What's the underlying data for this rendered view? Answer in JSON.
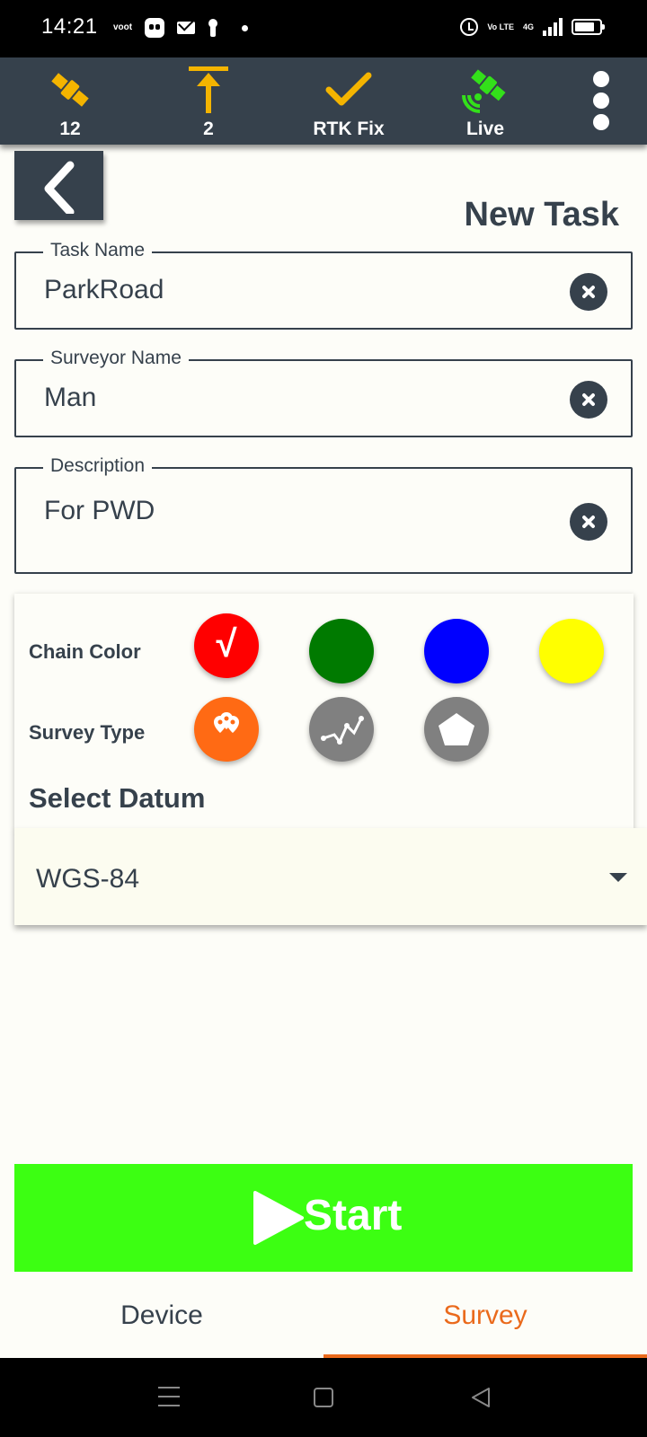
{
  "status_bar": {
    "time": "14:21",
    "left_icons": [
      "voot-icon",
      "app-icon",
      "mail-icon",
      "key-icon",
      "dot-icon"
    ],
    "right_icons": [
      "alarm-icon",
      "volte-icon",
      "signal-4g-icon",
      "battery-icon"
    ],
    "voot_label": "voot",
    "volte_label": "Vo LTE",
    "net_label": "4G"
  },
  "header": {
    "items": [
      {
        "icon": "satellite-icon",
        "label": "12",
        "color": "#f4b400"
      },
      {
        "icon": "antenna-height-icon",
        "label": "2",
        "color": "#f4b400"
      },
      {
        "icon": "check-icon",
        "label": "RTK Fix",
        "color": "#f4b400"
      },
      {
        "icon": "live-satellite-icon",
        "label": "Live",
        "color": "#33e01a"
      }
    ],
    "menu_icon": "more-vertical-icon",
    "background": "#36414c"
  },
  "page": {
    "back_icon": "chevron-left-icon",
    "title": "New Task"
  },
  "form": {
    "task_name": {
      "label": "Task Name",
      "value": "ParkRoad"
    },
    "surveyor_name": {
      "label": "Surveyor Name",
      "value": "Man"
    },
    "description": {
      "label": "Description",
      "value": "For PWD"
    }
  },
  "options": {
    "chain_color_label": "Chain Color",
    "chain_colors": [
      {
        "color": "#ff0000",
        "selected": true,
        "check": "√"
      },
      {
        "color": "#007a00",
        "selected": false
      },
      {
        "color": "#0000ff",
        "selected": false
      },
      {
        "color": "#ffff00",
        "selected": false
      }
    ],
    "survey_type_label": "Survey Type",
    "survey_types": [
      {
        "icon": "points-icon",
        "color": "#ff6a14",
        "selected": true
      },
      {
        "icon": "line-icon",
        "color": "#808080",
        "selected": false
      },
      {
        "icon": "polygon-icon",
        "color": "#808080",
        "selected": false
      }
    ],
    "datum_label": "Select Datum",
    "datum_value": "WGS-84"
  },
  "actions": {
    "start_label": "Start",
    "start_color": "#3cff12"
  },
  "tabs": [
    {
      "label": "Device",
      "active": false
    },
    {
      "label": "Survey",
      "active": true,
      "color": "#ea6a1c"
    }
  ]
}
